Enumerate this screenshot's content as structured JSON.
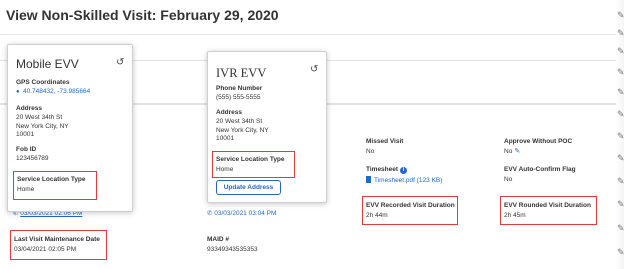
{
  "page": {
    "title": "View Non-Skilled Visit: February 29, 2020"
  },
  "mobile_evv": {
    "title": "Mobile EVV",
    "gps_label": "GPS Coordinates",
    "gps_value": "40.748432, -73.985664",
    "address_label": "Address",
    "address_line1": "20 West 34th St",
    "address_line2": "New York City, NY",
    "address_line3": "10001",
    "fob_label": "Fob ID",
    "fob_value": "123456789",
    "service_location_label": "Service Location Type",
    "service_location_value": "Home",
    "timestamp": "03/03/2021 02:06 PM"
  },
  "ivr_evv": {
    "title": "IVR EVV",
    "phone_label": "Phone Number",
    "phone_value": "(555) 555-5555",
    "address_label": "Address",
    "address_line1": "20 West 34th St",
    "address_line2": "New York City, NY",
    "address_line3": "10001",
    "service_location_label": "Service Location Type",
    "service_location_value": "Home",
    "update_button": "Update Address",
    "timestamp": "03/03/2021 03:04 PM"
  },
  "details": {
    "missed_visit_label": "Missed Visit",
    "missed_visit_value": "No",
    "timesheet_label": "Timesheet",
    "timesheet_file": "Timesheet.pdf (123 KB)",
    "recorded_duration_label": "EVV Recorded Visit Duration",
    "recorded_duration_value": "2h 44m",
    "approve_without_poc_label": "Approve Without POC",
    "approve_without_poc_value": "No",
    "auto_confirm_label": "EVV Auto-Confirm Flag",
    "auto_confirm_value": "No",
    "rounded_duration_label": "EVV Rounded Visit Duration",
    "rounded_duration_value": "2h 45m",
    "last_maintenance_label": "Last Visit Maintenance Date",
    "last_maintenance_value": "03/04/2021 02:05 PM",
    "maid_label": "MAID #",
    "maid_value": "93349343535353"
  },
  "colors": {
    "link": "#2367c9",
    "highlight": "#e23b3b"
  },
  "icons": [
    "history-icon",
    "map-pin-icon",
    "phone-icon",
    "info-icon",
    "file-icon",
    "edit-icon",
    "pencil-icon"
  ]
}
